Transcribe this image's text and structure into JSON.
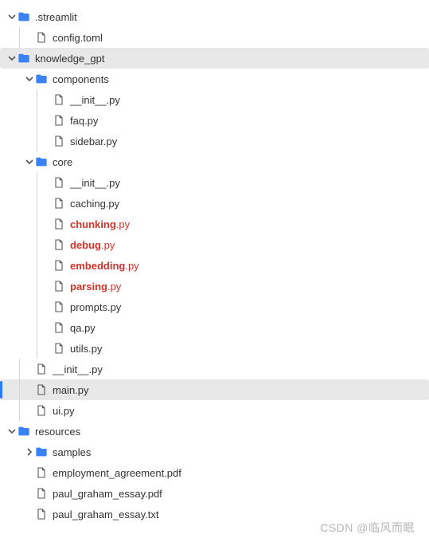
{
  "watermark": "CSDN @临风而眠",
  "tree": [
    {
      "depth": 0,
      "kind": "folder",
      "toggle": "down",
      "label": ".streamlit"
    },
    {
      "depth": 1,
      "kind": "file",
      "toggle": "",
      "label": "config.toml",
      "guides": [
        0
      ]
    },
    {
      "depth": 0,
      "kind": "folder",
      "toggle": "down",
      "label": "knowledge_gpt",
      "selected": true
    },
    {
      "depth": 1,
      "kind": "folder",
      "toggle": "down",
      "label": "components"
    },
    {
      "depth": 2,
      "kind": "file",
      "toggle": "",
      "label": "__init__.py",
      "guides": [
        1
      ]
    },
    {
      "depth": 2,
      "kind": "file",
      "toggle": "",
      "label": "faq.py",
      "guides": [
        1
      ]
    },
    {
      "depth": 2,
      "kind": "file",
      "toggle": "",
      "label": "sidebar.py",
      "guides": [
        1
      ]
    },
    {
      "depth": 1,
      "kind": "folder",
      "toggle": "down",
      "label": "core"
    },
    {
      "depth": 2,
      "kind": "file",
      "toggle": "",
      "label": "__init__.py",
      "guides": [
        1
      ]
    },
    {
      "depth": 2,
      "kind": "file",
      "toggle": "",
      "label": "caching.py",
      "guides": [
        1
      ]
    },
    {
      "depth": 2,
      "kind": "file",
      "toggle": "",
      "label": "chunking.py",
      "guides": [
        1
      ],
      "red": true,
      "stem": "chunking",
      "ext": ".py"
    },
    {
      "depth": 2,
      "kind": "file",
      "toggle": "",
      "label": "debug.py",
      "guides": [
        1
      ],
      "red": true,
      "stem": "debug",
      "ext": ".py"
    },
    {
      "depth": 2,
      "kind": "file",
      "toggle": "",
      "label": "embedding.py",
      "guides": [
        1
      ],
      "red": true,
      "stem": "embedding",
      "ext": ".py"
    },
    {
      "depth": 2,
      "kind": "file",
      "toggle": "",
      "label": "parsing.py",
      "guides": [
        1
      ],
      "red": true,
      "stem": "parsing",
      "ext": ".py"
    },
    {
      "depth": 2,
      "kind": "file",
      "toggle": "",
      "label": "prompts.py",
      "guides": [
        1
      ]
    },
    {
      "depth": 2,
      "kind": "file",
      "toggle": "",
      "label": "qa.py",
      "guides": [
        1
      ]
    },
    {
      "depth": 2,
      "kind": "file",
      "toggle": "",
      "label": "utils.py",
      "guides": [
        1
      ]
    },
    {
      "depth": 1,
      "kind": "file",
      "toggle": "",
      "label": "__init__.py",
      "guides": [
        0
      ]
    },
    {
      "depth": 1,
      "kind": "file",
      "toggle": "",
      "label": "main.py",
      "guides": [
        0
      ],
      "selected": true,
      "active": true
    },
    {
      "depth": 1,
      "kind": "file",
      "toggle": "",
      "label": "ui.py",
      "guides": [
        0
      ]
    },
    {
      "depth": 0,
      "kind": "folder",
      "toggle": "down",
      "label": "resources"
    },
    {
      "depth": 1,
      "kind": "folder",
      "toggle": "right",
      "label": "samples"
    },
    {
      "depth": 1,
      "kind": "file",
      "toggle": "",
      "label": "employment_agreement.pdf"
    },
    {
      "depth": 1,
      "kind": "file",
      "toggle": "",
      "label": "paul_graham_essay.pdf"
    },
    {
      "depth": 1,
      "kind": "file",
      "toggle": "",
      "label": "paul_graham_essay.txt"
    }
  ]
}
